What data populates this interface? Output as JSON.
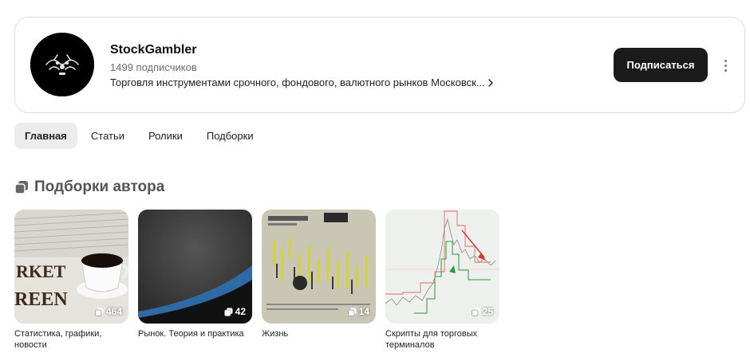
{
  "channel": {
    "name": "StockGambler",
    "subscribers": "1499 подписчиков",
    "description": "Торговля инструментами срочного, фондового, валютного рынков Московск...",
    "subscribe_label": "Подписаться"
  },
  "tabs": [
    {
      "label": "Главная",
      "active": true
    },
    {
      "label": "Статьи",
      "active": false
    },
    {
      "label": "Ролики",
      "active": false
    },
    {
      "label": "Подборки",
      "active": false
    }
  ],
  "section": {
    "title": "Подборки автора"
  },
  "collections": [
    {
      "title": "Статистика, графики, новости",
      "count": "464"
    },
    {
      "title": "Рынок. Теория и практика",
      "count": "42"
    },
    {
      "title": "Жизнь",
      "count": "14"
    },
    {
      "title": "Скрипты для торговых терминалов",
      "count": "25"
    }
  ],
  "icons": {
    "more": "more-vertical-icon",
    "collection": "collection-stack-icon",
    "chevron": "chevron-right-icon"
  },
  "colors": {
    "button_bg": "#1b1b1b",
    "active_tab_bg": "#ececec"
  }
}
